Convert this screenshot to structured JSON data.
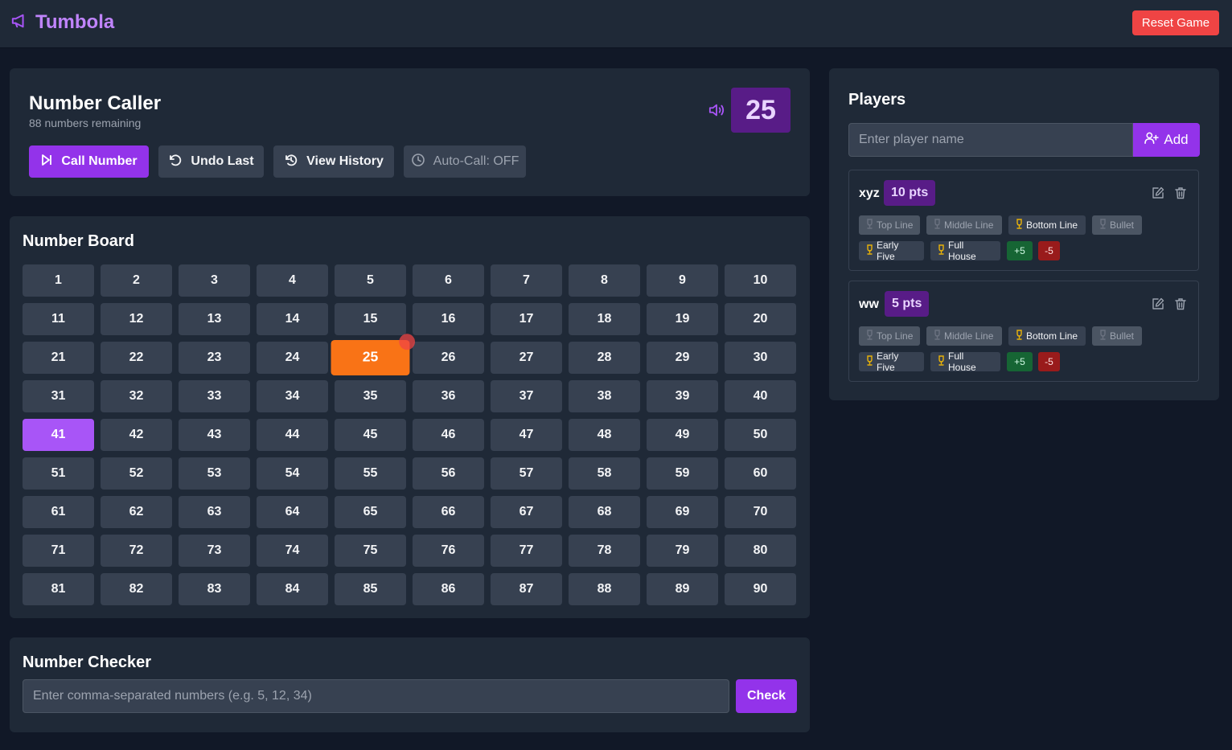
{
  "app": {
    "title": "Tumbola",
    "reset_label": "Reset Game"
  },
  "caller": {
    "title": "Number Caller",
    "remaining": "88 numbers remaining",
    "current_number": "25",
    "buttons": {
      "call": "Call Number",
      "undo": "Undo Last",
      "history": "View History",
      "auto": "Auto-Call: OFF"
    }
  },
  "board": {
    "title": "Number Board",
    "numbers": [
      "1",
      "2",
      "3",
      "4",
      "5",
      "6",
      "7",
      "8",
      "9",
      "10",
      "11",
      "12",
      "13",
      "14",
      "15",
      "16",
      "17",
      "18",
      "19",
      "20",
      "21",
      "22",
      "23",
      "24",
      "25",
      "26",
      "27",
      "28",
      "29",
      "30",
      "31",
      "32",
      "33",
      "34",
      "35",
      "36",
      "37",
      "38",
      "39",
      "40",
      "41",
      "42",
      "43",
      "44",
      "45",
      "46",
      "47",
      "48",
      "49",
      "50",
      "51",
      "52",
      "53",
      "54",
      "55",
      "56",
      "57",
      "58",
      "59",
      "60",
      "61",
      "62",
      "63",
      "64",
      "65",
      "66",
      "67",
      "68",
      "69",
      "70",
      "71",
      "72",
      "73",
      "74",
      "75",
      "76",
      "77",
      "78",
      "79",
      "80",
      "81",
      "82",
      "83",
      "84",
      "85",
      "86",
      "87",
      "88",
      "89",
      "90"
    ],
    "called": [
      "25",
      "41"
    ],
    "current": "25"
  },
  "checker": {
    "title": "Number Checker",
    "placeholder": "Enter comma-separated numbers (e.g. 5, 12, 34)",
    "check_label": "Check"
  },
  "players": {
    "title": "Players",
    "input_placeholder": "Enter player name",
    "add_label": "Add",
    "list": [
      {
        "name": "xyz",
        "score": "10 pts",
        "claims": {
          "top_line": "Top Line",
          "middle_line": "Middle Line",
          "bottom_line": "Bottom Line",
          "bullet": "Bullet",
          "early_five": "Early Five",
          "full_house": "Full House"
        },
        "claimed": [
          "bottom_line",
          "early_five",
          "full_house"
        ],
        "plus_label": "+5",
        "minus_label": "-5"
      },
      {
        "name": "ww",
        "score": "5 pts",
        "claims": {
          "top_line": "Top Line",
          "middle_line": "Middle Line",
          "bottom_line": "Bottom Line",
          "bullet": "Bullet",
          "early_five": "Early Five",
          "full_house": "Full House"
        },
        "claimed": [
          "bottom_line",
          "early_five",
          "full_house"
        ],
        "plus_label": "+5",
        "minus_label": "-5"
      }
    ]
  },
  "colors": {
    "accent": "#9333ea",
    "called": "#a855f7",
    "current": "#f97316",
    "danger": "#ef4444",
    "trophy_active": "#eab308",
    "trophy_inactive": "#6b7280"
  },
  "icons": [
    "megaphone-icon",
    "speaker-icon",
    "skip-forward-icon",
    "undo-icon",
    "history-icon",
    "clock-icon",
    "user-plus-icon",
    "edit-icon",
    "trash-icon",
    "trophy-icon"
  ]
}
